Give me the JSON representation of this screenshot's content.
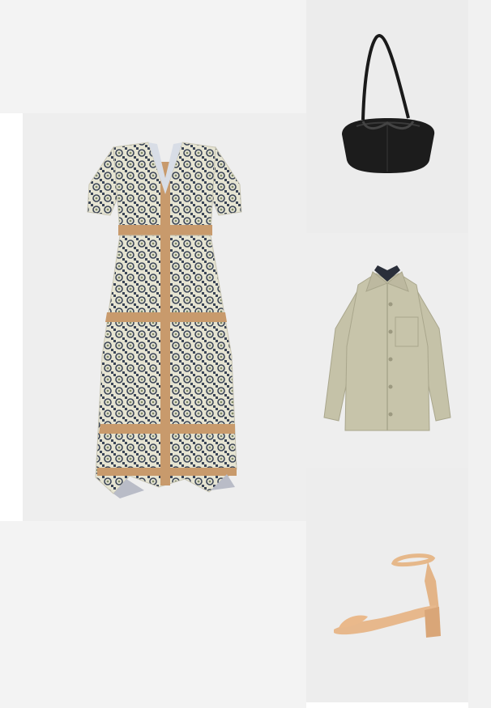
{
  "collage": {
    "items": [
      {
        "id": "dress",
        "icon": "patterned-midi-dress-icon"
      },
      {
        "id": "bag",
        "icon": "black-leather-handbag-icon"
      },
      {
        "id": "jacket",
        "icon": "khaki-overshirt-jacket-icon"
      },
      {
        "id": "sandal",
        "icon": "nude-block-heel-sandal-icon"
      }
    ],
    "colors": {
      "background": "#ffffff",
      "panel": "#eeeeee",
      "dress_tan": "#c89a6c",
      "dress_pattern": "#3c4658",
      "dress_cream": "#e8e6d6",
      "bag_black": "#1a1a1a",
      "jacket_khaki": "#c4c1a6",
      "sandal_nude": "#e8b98d"
    }
  }
}
